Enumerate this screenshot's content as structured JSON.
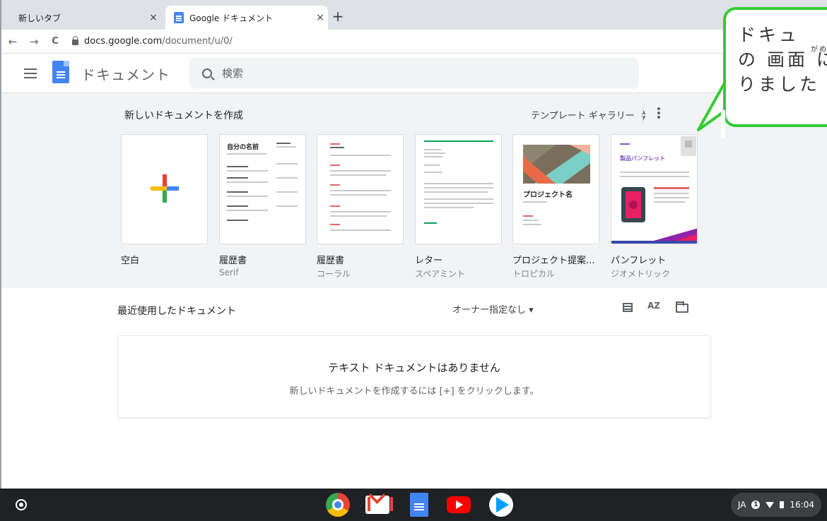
{
  "browser": {
    "tabs": [
      {
        "label": "新しいタブ",
        "close": "×"
      },
      {
        "label": "Google ドキュメント",
        "close": "×"
      }
    ],
    "new_tab": "+",
    "nav": {
      "back": "←",
      "forward": "→",
      "reload": "C"
    },
    "url_host": "docs.google.com",
    "url_path": "/document/u/0/"
  },
  "header": {
    "app_name": "ドキュメント",
    "search_placeholder": "検索"
  },
  "templates": {
    "title": "新しいドキュメントを作成",
    "gallery_label": "テンプレート ギャラリー",
    "items": [
      {
        "name": "空白",
        "sub": ""
      },
      {
        "name": "履歴書",
        "sub": "Serif"
      },
      {
        "name": "履歴書",
        "sub": "コーラル"
      },
      {
        "name": "レター",
        "sub": "スペアミント"
      },
      {
        "name": "プロジェクト提案...",
        "sub": "トロピカル"
      },
      {
        "name": "パンフレット",
        "sub": "ジオメトリック"
      }
    ],
    "thumb_text": {
      "resume_heading": "自分の名前",
      "project_heading": "プロジェクト名",
      "brochure_heading": "製品パンフレット"
    }
  },
  "recent": {
    "title": "最近使用したドキュメント",
    "owner_filter": "オーナー指定なし ▾",
    "sort_label": "AZ",
    "empty_title": "テキスト ドキュメントはありません",
    "empty_hint": "新しいドキュメントを作成するには [+] をクリックします。"
  },
  "callout": {
    "line1": "ドキュ",
    "ruby": "がめん",
    "line2": "の 画面 に",
    "line3": "りました"
  },
  "shelf": {
    "apps": [
      "chrome-icon",
      "gmail-icon",
      "docs-icon",
      "youtube-icon",
      "play-store-icon"
    ],
    "status": {
      "lang": "JA",
      "notifications": "1",
      "time": "16:04"
    }
  },
  "colors": {
    "accent_green": "#33cc33",
    "docs_blue": "#4285f4",
    "shelf": "#202124"
  }
}
